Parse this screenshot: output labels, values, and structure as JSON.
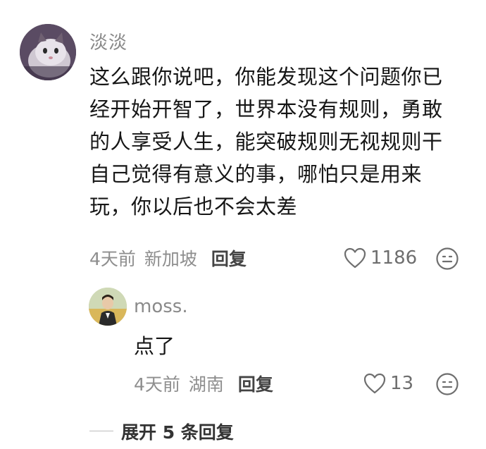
{
  "main_comment": {
    "username": "淡淡",
    "text": "这么跟你说吧，你能发现这个问题你已经开始开智了，世界本没有规则，勇敢的人享受人生，能突破规则无视规则干自己觉得有意义的事，哪怕只是用来玩，你以后也不会太差",
    "time": "4天前",
    "location": "新加坡",
    "reply_label": "回复",
    "likes": "1186",
    "avatar_icon": "cat-avatar",
    "heart_icon": "heart-icon",
    "emoji_icon": "emoji-icon"
  },
  "reply_comment": {
    "username": "moss.",
    "text": "点了",
    "time": "4天前",
    "location": "湖南",
    "reply_label": "回复",
    "likes": "13",
    "avatar_icon": "person-avatar",
    "heart_icon": "heart-icon",
    "emoji_icon": "emoji-icon"
  },
  "expand": {
    "label": "展开 5 条回复"
  }
}
